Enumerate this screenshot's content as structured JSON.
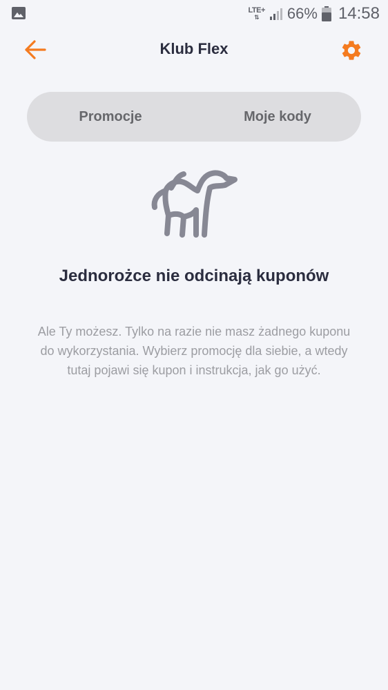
{
  "status_bar": {
    "network": "LTE+",
    "battery_percent": "66%",
    "time": "14:58"
  },
  "header": {
    "title": "Klub Flex",
    "accent_color": "#f47b20"
  },
  "tabs": [
    {
      "label": "Promocje"
    },
    {
      "label": "Moje kody"
    }
  ],
  "empty_state": {
    "icon": "unicorn-icon",
    "title": "Jednorożce nie odcinają kuponów",
    "line1": "Ale Ty możesz. Tylko na razie nie masz żadnego kuponu",
    "line2": "do wykorzystania. Wybierz promocję dla siebie, a wtedy",
    "line3": "tutaj pojawi się kupon i instrukcja, jak go użyć."
  }
}
